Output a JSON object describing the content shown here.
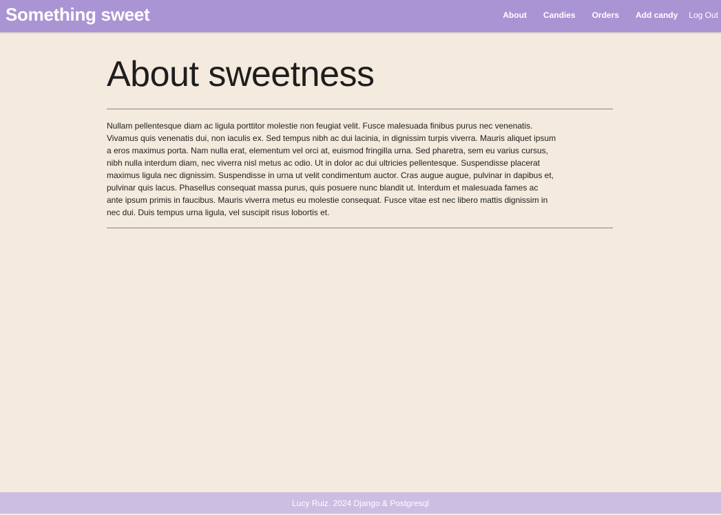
{
  "nav": {
    "brand": "Something sweet",
    "links": [
      "About",
      "Candies",
      "Orders",
      "Add candy"
    ],
    "logout": "Log Out"
  },
  "main": {
    "title": "About sweetness",
    "lines": [
      "Nullam pellentesque diam ac ligula porttitor molestie non feugiat velit. Fusce malesuada finibus purus nec venenatis.",
      "Vivamus quis venenatis dui, non iaculis ex. Sed tempus nibh ac dui lacinia, in dignissim turpis viverra. Mauris aliquet ipsum",
      "a eros maximus porta. Nam nulla erat, elementum vel orci at, euismod fringilla urna. Sed pharetra, sem eu varius cursus,",
      "nibh nulla interdum diam, nec viverra nisl metus ac odio. Ut in dolor ac dui ultricies pellentesque. Suspendisse placerat",
      "maximus ligula nec dignissim. Suspendisse in urna ut velit condimentum auctor. Cras augue augue, pulvinar in dapibus et,",
      "pulvinar quis lacus. Phasellus consequat massa purus, quis posuere nunc blandit ut. Interdum et malesuada fames ac",
      "ante ipsum primis in faucibus. Mauris viverra metus eu molestie consequat. Fusce vitae est nec libero mattis dignissim in",
      "nec dui. Duis tempus urna ligula, vel suscipit risus lobortis et."
    ]
  },
  "footer": {
    "text": "Lucy Ruiz. 2024 Django & Postgresql"
  }
}
